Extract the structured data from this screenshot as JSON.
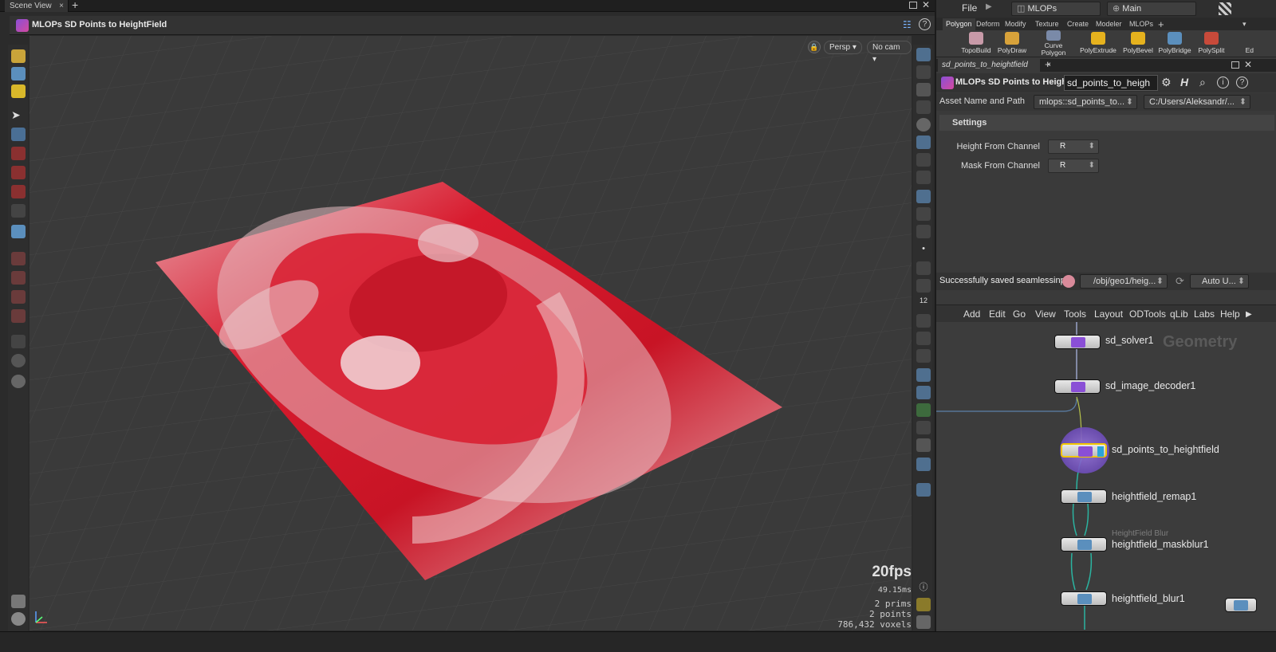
{
  "scene_tab": {
    "label": "Scene View",
    "close": "×",
    "add": "+"
  },
  "viewport": {
    "title": "MLOPs SD Points to HeightField",
    "persp": "Persp ▾",
    "cam": "No cam ▾",
    "fps": "20fps",
    "ms": "49.15ms",
    "prims": "2  prims",
    "points": "2 points",
    "voxels": "786,432 voxels"
  },
  "top_menu": {
    "file": "File",
    "desktop": "MLOPs",
    "main": "Main"
  },
  "shelf_tabs": [
    "Polygon",
    "Deform",
    "Modify",
    "Texture",
    "Create",
    "Modeler",
    "MLOPs"
  ],
  "shelf_tools": [
    "TopoBuild",
    "PolyDraw",
    "Curve\nPolygon",
    "PolyExtrude",
    "PolyBevel",
    "PolyBridge",
    "PolySplit",
    "Ed"
  ],
  "param_tab": "sd_points_to_heightfield",
  "param": {
    "node_type": "MLOPs SD Points to Heigh...",
    "node_name": "sd_points_to_heigh",
    "asset_label": "Asset Name and Path",
    "asset_name": "mlops::sd_points_to...",
    "asset_path": "C:/Users/Aleksandr/...",
    "settings": "Settings",
    "height_label": "Height From Channel",
    "height_value": "R",
    "mask_label": "Mask From Channel",
    "mask_value": "R"
  },
  "status": {
    "message": "Successfully saved seamlessinp...",
    "path": "/obj/geo1/heig...",
    "update": "Auto U..."
  },
  "net_menu": [
    "Add",
    "Edit",
    "Go",
    "View",
    "Tools",
    "Layout",
    "ODTools",
    "qLib",
    "Labs",
    "Help"
  ],
  "network": {
    "context": "Geometry",
    "nodes": [
      {
        "name": "sd_solver1",
        "sub": ""
      },
      {
        "name": "sd_image_decoder1",
        "sub": ""
      },
      {
        "name": "sd_points_to_heightfield",
        "sub": ""
      },
      {
        "name": "heightfield_remap1",
        "sub": ""
      },
      {
        "name": "heightfield_maskblur1",
        "sub": "HeightField Blur"
      },
      {
        "name": "heightfield_blur1",
        "sub": ""
      }
    ]
  },
  "colors": {
    "plane": "#d81b2e",
    "node_selected": "#f2c500",
    "wire": "#2bb3a0"
  }
}
